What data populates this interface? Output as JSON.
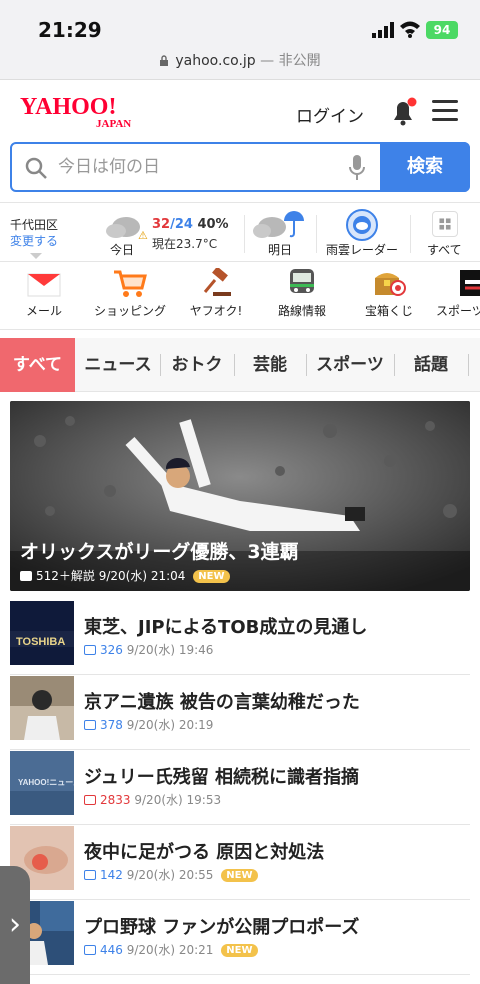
{
  "status_bar": {
    "time": "21:29",
    "battery": "94"
  },
  "browser": {
    "domain": "yahoo.co.jp",
    "privacy": "— 非公開"
  },
  "header": {
    "logo_text": "YAHOO!",
    "logo_sub": "JAPAN",
    "login": "ログイン"
  },
  "search": {
    "placeholder": "今日は何の日",
    "button": "検索"
  },
  "weather": {
    "location": "千代田区",
    "change": "変更する",
    "today_label": "今日",
    "high": "32",
    "low": "24",
    "rain": "40%",
    "now": "現在23.7°C",
    "tomorrow_label": "明日",
    "radar_label": "雨雲レーダー",
    "all_label": "すべて"
  },
  "services": [
    {
      "label": "メール",
      "icon": "mail-icon"
    },
    {
      "label": "ショッピング",
      "icon": "cart-icon"
    },
    {
      "label": "ヤフオク!",
      "icon": "auction-hammer-icon"
    },
    {
      "label": "路線情報",
      "icon": "train-icon"
    },
    {
      "label": "宝箱くじ",
      "icon": "treasure-icon"
    },
    {
      "label": "スポーツ",
      "icon": "sports-icon"
    }
  ],
  "tabs": [
    "すべて",
    "ニュース",
    "おトク",
    "芸能",
    "スポーツ",
    "話題"
  ],
  "hero": {
    "title": "オリックスがリーグ優勝、3連覇",
    "comments": "512＋解説",
    "date": "9/20(水) 21:04",
    "badge": "NEW"
  },
  "news": [
    {
      "title": "東芝、JIPによるTOB成立の見通し",
      "comments": "326",
      "date": "9/20(水) 19:46",
      "thumb_text": "TOSHIBA"
    },
    {
      "title": "京アニ遺族 被告の言葉幼稚だった",
      "comments": "378",
      "date": "9/20(水) 20:19"
    },
    {
      "title": "ジュリー氏残留 相続税に識者指摘",
      "comments": "2833",
      "date": "9/20(水) 19:53",
      "thumb_text": "YAHOO!ニュース"
    },
    {
      "title": "夜中に足がつる 原因と対処法",
      "comments": "142",
      "date": "9/20(水) 20:55",
      "badge": "NEW"
    },
    {
      "title": "プロ野球 ファンが公開プロポーズ",
      "comments": "446",
      "date": "9/20(水) 20:21",
      "badge": "NEW"
    }
  ],
  "colors": {
    "accent": "#3e82e8",
    "brand": "#ff0033",
    "tab_active": "#f0686e"
  }
}
